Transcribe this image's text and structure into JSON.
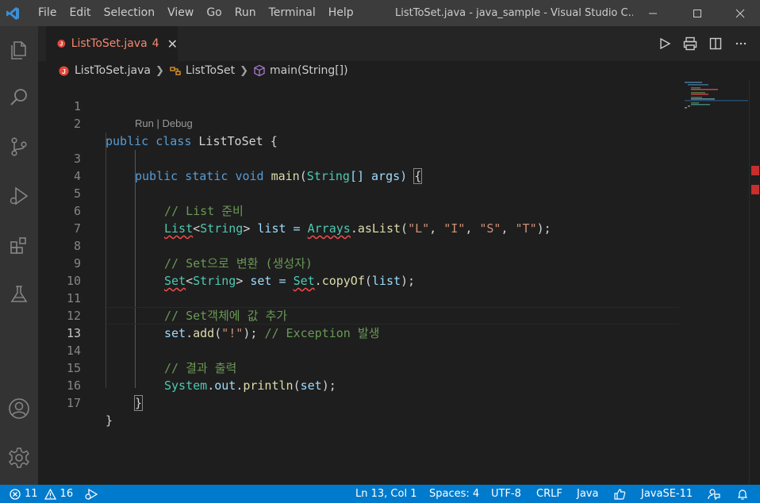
{
  "titlebar": {
    "menu": [
      "File",
      "Edit",
      "Selection",
      "View",
      "Go",
      "Run",
      "Terminal",
      "Help"
    ],
    "window_title": "ListToSet.java - java_sample - Visual Studio C..."
  },
  "activity_bar": {
    "icons": [
      "files-icon",
      "search-icon",
      "source-control-icon",
      "run-debug-icon",
      "extensions-icon",
      "testing-icon",
      "account-icon",
      "settings-gear-icon"
    ]
  },
  "tab": {
    "label": "ListToSet.java",
    "problem_count": "4",
    "icon_letter": "J"
  },
  "breadcrumb": {
    "file": "ListToSet.java",
    "class": "ListToSet",
    "method": "main(String[])"
  },
  "codelens": "Run | Debug",
  "line_numbers": [
    "1",
    "2",
    "3",
    "4",
    "5",
    "6",
    "7",
    "8",
    "9",
    "10",
    "11",
    "12",
    "13",
    "14",
    "15",
    "16",
    "17"
  ],
  "code": {
    "l2": {
      "kw1": "public",
      "kw2": "class",
      "name": " ListToSet {"
    },
    "l3": {
      "kw1": "public",
      "kw2": "static",
      "kw3": "void",
      "fn": "main",
      "ty": "String",
      "rest": "[] args) "
    },
    "l5": "// List 준비",
    "l6": {
      "t1": "List",
      "t2": "String",
      "v": " list = ",
      "t3": "Arrays",
      "fn": "asList",
      "s1": "\"L\"",
      "s2": "\"I\"",
      "s3": "\"S\"",
      "s4": "\"T\""
    },
    "l8": "// Set으로 변환 (생성자)",
    "l9": {
      "t1": "Set",
      "t2": "String",
      "v": " set = ",
      "t3": "Set",
      "fn": "copyOf",
      "arg": "list"
    },
    "l11": "// Set객체에 값 추가",
    "l12": {
      "v": "set",
      "fn": "add",
      "s": "\"!\"",
      "cm": "// Exception 발생"
    },
    "l14": "// 결과 출력",
    "l15": {
      "t1": "System",
      "v1": "out",
      "fn": "println",
      "arg": "set"
    },
    "l16": "}",
    "l17": "}"
  },
  "statusbar": {
    "errors": "11",
    "warnings": "16",
    "position": "Ln 13, Col 1",
    "spaces": "Spaces: 4",
    "encoding": "UTF-8",
    "eol": "CRLF",
    "language": "Java",
    "jdk": "JavaSE-11"
  },
  "colors": {
    "accent": "#007acc",
    "error": "#f14c4c",
    "tab_error_text": "#f48771"
  }
}
